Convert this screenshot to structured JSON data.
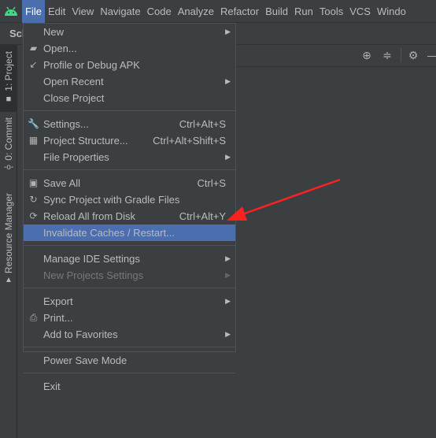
{
  "menubar": {
    "items": [
      "File",
      "Edit",
      "View",
      "Navigate",
      "Code",
      "Analyze",
      "Refactor",
      "Build",
      "Run",
      "Tools",
      "VCS",
      "Windo"
    ]
  },
  "tab": {
    "label": "Sch"
  },
  "left_tabs": [
    "1: Project",
    "0: Commit",
    "Resource Manager"
  ],
  "file_menu": {
    "groups": [
      [
        {
          "label": "New",
          "submenu": true
        },
        {
          "label": "Open...",
          "icon": "folder-open-icon"
        },
        {
          "label": "Profile or Debug APK",
          "icon": "profile-apk-icon"
        },
        {
          "label": "Open Recent",
          "submenu": true
        },
        {
          "label": "Close Project"
        }
      ],
      [
        {
          "label": "Settings...",
          "shortcut": "Ctrl+Alt+S",
          "icon": "wrench-icon"
        },
        {
          "label": "Project Structure...",
          "shortcut": "Ctrl+Alt+Shift+S",
          "icon": "project-structure-icon"
        },
        {
          "label": "File Properties",
          "submenu": true
        }
      ],
      [
        {
          "label": "Save All",
          "shortcut": "Ctrl+S",
          "icon": "save-icon"
        },
        {
          "label": "Sync Project with Gradle Files",
          "icon": "gradle-sync-icon"
        },
        {
          "label": "Reload All from Disk",
          "shortcut": "Ctrl+Alt+Y",
          "icon": "reload-icon"
        },
        {
          "label": "Invalidate Caches / Restart...",
          "highlighted": true
        }
      ],
      [
        {
          "label": "Manage IDE Settings",
          "submenu": true
        },
        {
          "label": "New Projects Settings",
          "submenu": true,
          "disabled": true
        }
      ],
      [
        {
          "label": "Export",
          "submenu": true
        },
        {
          "label": "Print...",
          "icon": "print-icon"
        },
        {
          "label": "Add to Favorites",
          "submenu": true
        }
      ],
      [
        {
          "label": "Power Save Mode"
        }
      ],
      [
        {
          "label": "Exit"
        }
      ]
    ]
  },
  "colors": {
    "highlight": "#4b6eaf",
    "annotation_arrow": "#ff2020",
    "background": "#3c3f41"
  }
}
